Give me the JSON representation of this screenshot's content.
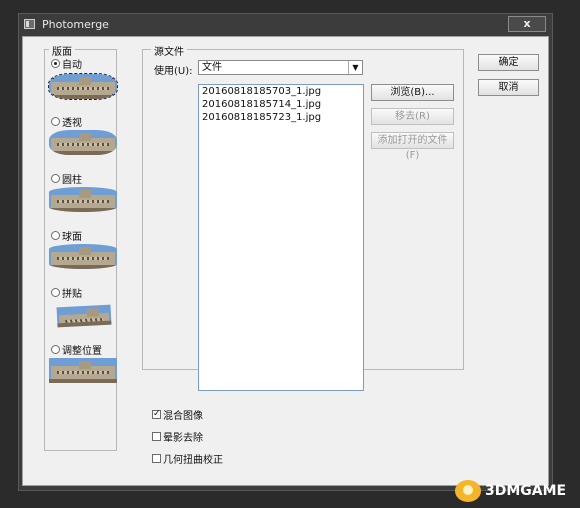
{
  "window": {
    "title": "Photomerge",
    "close_label": "x"
  },
  "layout_group": {
    "legend": "版面",
    "options": [
      {
        "label": "自动",
        "selected": true
      },
      {
        "label": "透视",
        "selected": false
      },
      {
        "label": "圆柱",
        "selected": false
      },
      {
        "label": "球面",
        "selected": false
      },
      {
        "label": "拼贴",
        "selected": false
      },
      {
        "label": "调整位置",
        "selected": false
      }
    ]
  },
  "source_group": {
    "legend": "源文件",
    "use_label": "使用(U):",
    "use_value": "文件",
    "files": [
      "20160818185703_1.jpg",
      "20160818185714_1.jpg",
      "20160818185723_1.jpg"
    ],
    "browse_label": "浏览(B)...",
    "remove_label": "移去(R)",
    "add_open_label": "添加打开的文件(F)"
  },
  "options": {
    "blend_images": {
      "label": "混合图像",
      "checked": true
    },
    "vignette_removal": {
      "label": "晕影去除",
      "checked": false
    },
    "geometric_distortion": {
      "label": "几何扭曲校正",
      "checked": false
    }
  },
  "buttons": {
    "ok": "确定",
    "cancel": "取消"
  },
  "watermark": {
    "text": "3DMGAME"
  },
  "icons": {
    "check": "✓",
    "dropdown": "▼"
  }
}
